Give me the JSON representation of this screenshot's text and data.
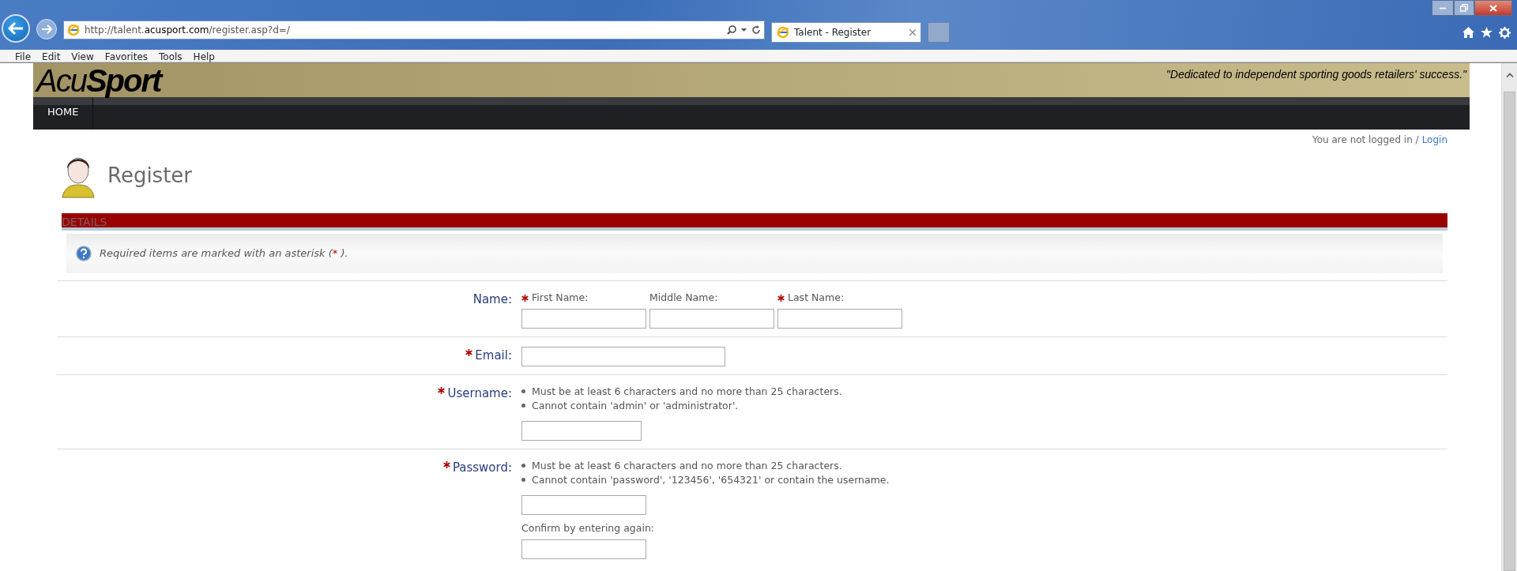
{
  "browser": {
    "url": "http://talent.**acusport.com**/register.asp?d=/",
    "tabs": [
      {
        "title": "Talent - Register",
        "selected": true
      }
    ],
    "menu": [
      "File",
      "Edit",
      "View",
      "Favorites",
      "Tools",
      "Help"
    ]
  },
  "page": {
    "logo": "Acu**Sport**",
    "tagline": "\"Dedicated to independent sporting goods retailers' success.\"",
    "nav": [
      "HOME"
    ],
    "login_status": {
      "text": "You are not logged in /",
      "link": "Login"
    },
    "title": "Register",
    "section": "DETAILS",
    "info": {
      "before": "Required items are marked with an asterisk (",
      "mark": "*",
      "after": " )."
    },
    "rows": [
      {
        "label": "Name:",
        "required": false,
        "kind": "names",
        "subfields": [
          {
            "label": "First Name:",
            "required": true
          },
          {
            "label": "Middle Name:",
            "required": false
          },
          {
            "label": "Last Name:",
            "required": true
          }
        ]
      },
      {
        "label": "Email:",
        "required": true,
        "kind": "input"
      },
      {
        "label": "Username:",
        "required": true,
        "kind": "rules",
        "rules": [
          "Must be at least 6 characters and no more than 25 characters.",
          "Cannot contain 'admin' or 'administrator'."
        ]
      },
      {
        "label": "Password:",
        "required": true,
        "kind": "rules",
        "rules": [
          "Must be at least 6 characters and no more than 25 characters.",
          "Cannot contain 'password', '123456', '654321' or contain the username."
        ],
        "confirm_label": "Confirm by entering again:"
      }
    ]
  }
}
